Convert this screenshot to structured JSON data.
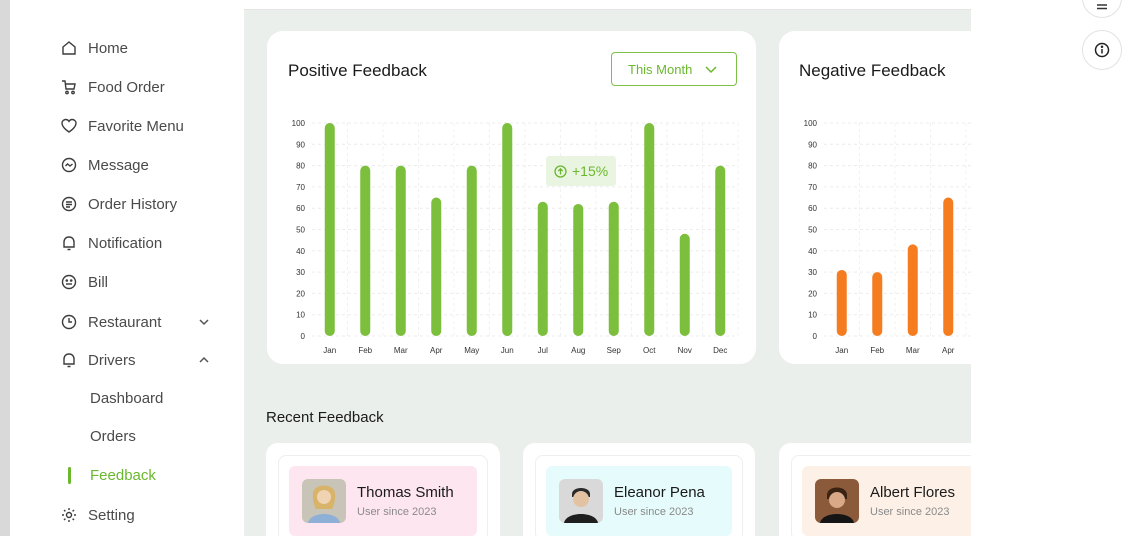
{
  "sidebar": {
    "items": [
      {
        "label": "Home",
        "icon": "home-icon"
      },
      {
        "label": "Food Order",
        "icon": "food-order-icon"
      },
      {
        "label": "Favorite Menu",
        "icon": "heart-icon"
      },
      {
        "label": "Message",
        "icon": "message-icon"
      },
      {
        "label": "Order History",
        "icon": "order-history-icon"
      },
      {
        "label": "Notification",
        "icon": "bell-icon"
      },
      {
        "label": "Bill",
        "icon": "bill-icon"
      },
      {
        "label": "Restaurant",
        "icon": "restaurant-icon"
      },
      {
        "label": "Drivers",
        "icon": "bell-icon"
      }
    ],
    "sub_items": [
      "Dashboard",
      "Orders",
      "Feedback"
    ],
    "setting_label": "Setting",
    "accent": "#6ab82d"
  },
  "positive": {
    "title": "Positive Feedback",
    "period": "This Month",
    "badge": "+15%",
    "color": "#7cbf3c"
  },
  "negative": {
    "title": "Negative Feedback",
    "color": "#f57c1f"
  },
  "chart_data": [
    {
      "type": "bar",
      "title": "Positive Feedback",
      "categories": [
        "Jan",
        "Feb",
        "Mar",
        "Apr",
        "May",
        "Jun",
        "Jul",
        "Aug",
        "Sep",
        "Oct",
        "Nov",
        "Dec"
      ],
      "values": [
        100,
        80,
        80,
        65,
        80,
        100,
        63,
        62,
        63,
        100,
        48,
        80
      ],
      "ylim": [
        0,
        100
      ],
      "yticks": [
        0,
        10,
        20,
        30,
        40,
        50,
        60,
        70,
        80,
        90,
        100
      ],
      "grid": true
    },
    {
      "type": "bar",
      "title": "Negative Feedback",
      "categories": [
        "Jan",
        "Feb",
        "Mar",
        "Apr"
      ],
      "values": [
        31,
        30,
        43,
        65
      ],
      "ylim": [
        0,
        100
      ],
      "yticks": [
        0,
        10,
        20,
        30,
        40,
        50,
        60,
        70,
        80,
        90,
        100
      ],
      "grid": true
    }
  ],
  "recent": {
    "title": "Recent Feedback",
    "users": [
      {
        "name": "Thomas Smith",
        "since": "User since 2023",
        "bg": "#fde6f0"
      },
      {
        "name": "Eleanor Pena",
        "since": "User since 2023",
        "bg": "#e6fbfb"
      },
      {
        "name": "Albert Flores",
        "since": "User since 2023",
        "bg": "#fdf1e7"
      }
    ]
  }
}
